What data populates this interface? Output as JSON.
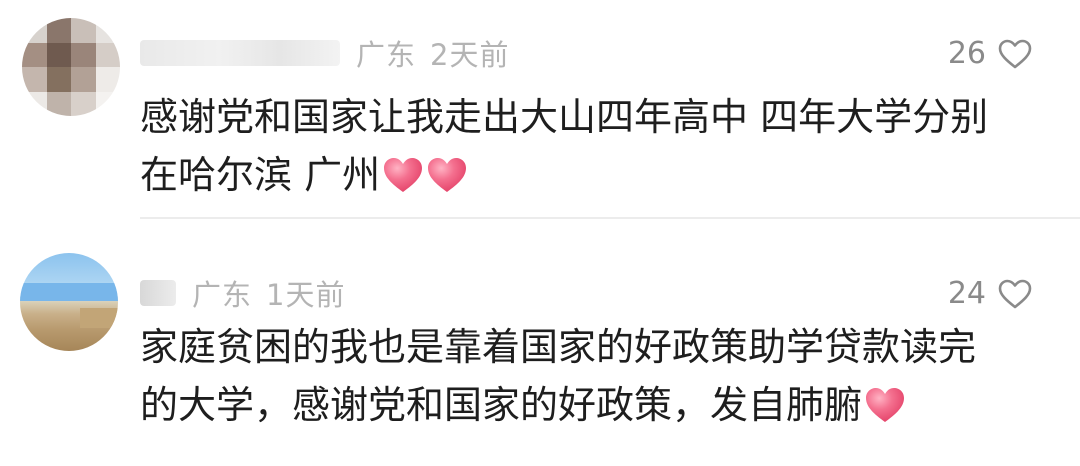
{
  "comments": [
    {
      "location": "广东",
      "time": "2天前",
      "likes": "26",
      "text_line1": "感谢党和国家让我走出大山四年高中 四年大学分别",
      "text_line2": "在哈尔滨 广州",
      "emoji": [
        "heart-emoji",
        "heart-emoji"
      ]
    },
    {
      "location": "广东",
      "time": "1天前",
      "likes": "24",
      "text_line1": "家庭贫困的我也是靠着国家的好政策助学贷款读完",
      "text_line2": "的大学，感谢党和国家的好政策，发自肺腑",
      "emoji": [
        "heart-emoji"
      ]
    }
  ],
  "colors": {
    "text": "#1e1e1e",
    "meta": "#b4b4b4",
    "like_count": "#8a8a8a",
    "heart_emoji": "#f0587a",
    "divider": "#ececec"
  },
  "icons": {
    "like": "heart-outline-icon",
    "emoji": "heart-emoji"
  }
}
